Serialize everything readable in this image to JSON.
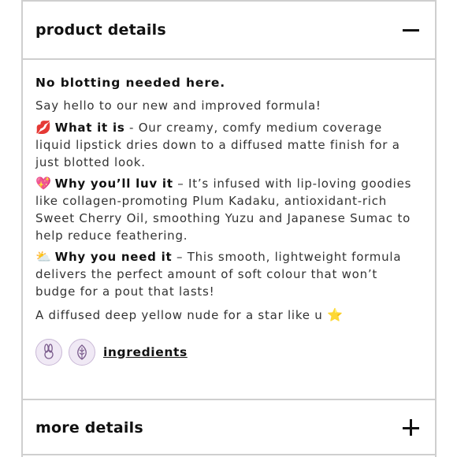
{
  "product_details": {
    "title": "product details",
    "toggle_icon": "minus-icon"
  },
  "content": {
    "headline": "No blotting needed here.",
    "intro": "Say hello to our new and improved formula!",
    "what_it_is": {
      "emoji": "💋",
      "lead": "What it is",
      "text": " - Our creamy, comfy medium coverage liquid lipstick dries down to a diffused matte finish for a just blotted look."
    },
    "why_luv": {
      "emoji": "💖",
      "lead": "Why you’ll luv it",
      "text": " – It’s infused with lip-loving goodies like collagen-promoting Plum Kadaku, antioxidant-rich Sweet Cherry Oil, smoothing Yuzu and Japanese Sumac to help reduce feathering."
    },
    "why_need": {
      "emoji": "⛅",
      "lead": "Why you need it",
      "text": " – This smooth, lightweight formula delivers the perfect amount of soft colour that won’t budge for a pout that lasts!"
    },
    "closing": "A diffused deep yellow nude for a star like u",
    "closing_emoji": "⭐",
    "ingredients_link": "ingredients"
  },
  "more_details": {
    "title": "more details",
    "toggle_icon": "plus-icon"
  },
  "colors": {
    "border": "#cfcfcf",
    "badge_bg": "#f0e9f5",
    "badge_border": "#c9b8d6"
  }
}
